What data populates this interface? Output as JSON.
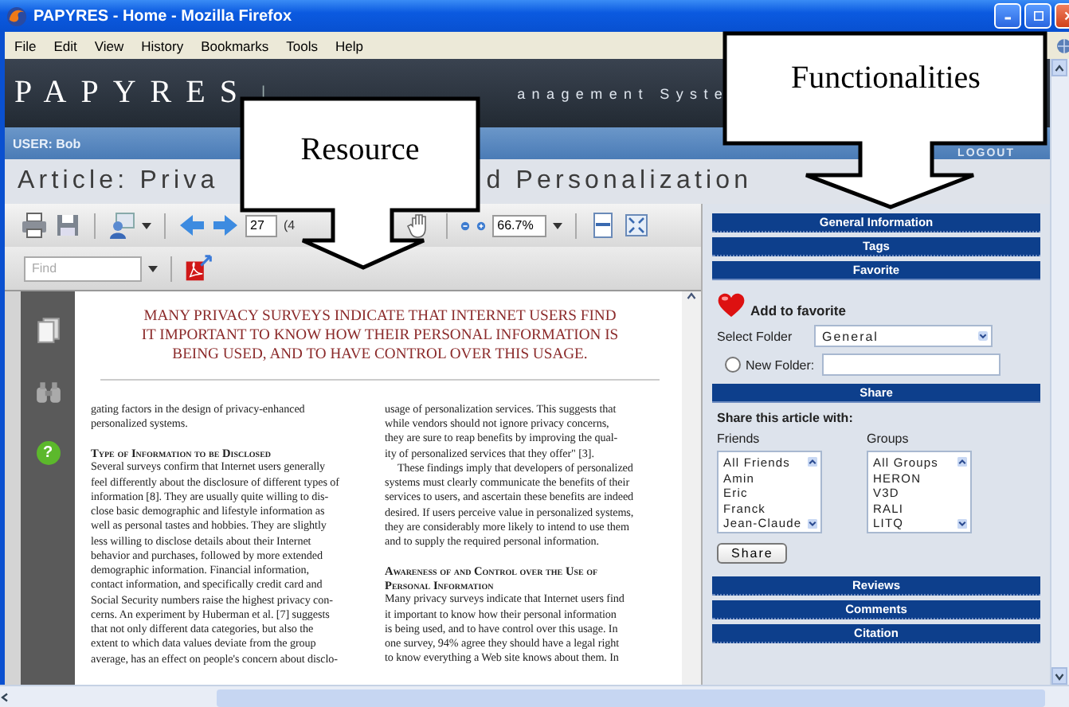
{
  "window": {
    "title": "PAPYRES - Home - Mozilla Firefox"
  },
  "menu": [
    "File",
    "Edit",
    "View",
    "History",
    "Bookmarks",
    "Tools",
    "Help"
  ],
  "header": {
    "brand": "PAPYRES",
    "separator": "|",
    "tagline": "anagement Syste"
  },
  "user_bar": {
    "user": "USER: Bob",
    "logout": "LOGOUT"
  },
  "article_title": {
    "left": "Article: Priva",
    "right": "d Personalization"
  },
  "pdf_toolbar": {
    "help": "?",
    "page": "27",
    "page_count": "(4",
    "zoom": "66.7%",
    "find_placeholder": "Find"
  },
  "document": {
    "pull_quote": "MANY PRIVACY SURVEYS INDICATE THAT INTERNET USERS FIND\nIT IMPORTANT TO KNOW HOW THEIR PERSONAL INFORMATION IS\nBEING USED, AND TO HAVE CONTROL OVER THIS USAGE.",
    "columns": [
      [
        {
          "kind": "paragraph",
          "text": "gating factors in the design of privacy-enhanced\npersonalized systems."
        },
        {
          "kind": "heading",
          "text": "Type of Information to be Disclosed"
        },
        {
          "kind": "paragraph",
          "text": "Several surveys confirm that Internet users generally\nfeel differently about the disclosure of different types of\ninformation [8]. They are usually quite willing to dis-\nclose basic demographic and lifestyle information as\nwell as personal tastes and hobbies. They are slightly\nless willing to disclose details about their Internet\nbehavior and purchases, followed by more extended\ndemographic information. Financial information,\ncontact information, and specifically credit card and\nSocial Security numbers raise the highest privacy con-\ncerns. An experiment by Huberman et al. [7] suggests\nthat not only different data categories, but also the\nextent to which data values deviate from the group\naverage, has an effect on people's concern about disclo-"
        }
      ],
      [
        {
          "kind": "paragraph",
          "text": "usage of personalization services. This suggests that\nwhile vendors should not ignore privacy concerns,\nthey are sure to reap benefits by improving the qual-\nity of personalized services that they offer\" [3]."
        },
        {
          "kind": "indented",
          "text": "These findings imply that developers of personalized\nsystems must clearly communicate the benefits of their\nservices to users, and ascertain these benefits are indeed\ndesired. If users perceive value in personalized systems,\nthey are considerably more likely to intend to use them\nand to supply the required personal information."
        },
        {
          "kind": "heading",
          "text": "Awareness of and Control over the Use of\nPersonal Information"
        },
        {
          "kind": "paragraph",
          "text": "Many privacy surveys indicate that Internet users find\nit important to know how their personal information\nis being used, and to have control over this usage. In\none survey, 94% agree they should have a legal right\nto know everything a Web site knows about them. In"
        }
      ]
    ]
  },
  "panel": {
    "sections": [
      {
        "title": "General Information",
        "expanded": false
      },
      {
        "title": "Tags",
        "expanded": false
      },
      {
        "title": "Favorite",
        "expanded": true,
        "kind": "favorite"
      },
      {
        "title": "Share",
        "expanded": true,
        "kind": "share"
      },
      {
        "title": "Reviews",
        "expanded": false
      },
      {
        "title": "Comments",
        "expanded": false
      },
      {
        "title": "Citation",
        "expanded": false
      }
    ],
    "favorite": {
      "add_label": "Add to favorite",
      "folder_label": "Select Folder",
      "folder_value": "General",
      "new_folder_label": "New Folder:",
      "new_folder_selected": false
    },
    "share": {
      "heading": "Share this article with:",
      "friends_label": "Friends",
      "groups_label": "Groups",
      "button": "Share",
      "friends": [
        {
          "name": "All Friends",
          "selected": false
        },
        {
          "name": "Amin",
          "selected": false
        },
        {
          "name": "Eric",
          "selected": false
        },
        {
          "name": "Franck",
          "selected": false
        },
        {
          "name": "Jean-Claude",
          "selected": false
        }
      ],
      "groups": [
        {
          "name": "All Groups",
          "selected": false
        },
        {
          "name": "HERON",
          "selected": false
        },
        {
          "name": "V3D",
          "selected": false
        },
        {
          "name": "RALI",
          "selected": false
        },
        {
          "name": "LITQ",
          "selected": false
        }
      ]
    }
  },
  "callouts": [
    {
      "label": "Resource",
      "kind": "resource"
    },
    {
      "label": "Functionalities",
      "kind": "functionalities"
    }
  ]
}
